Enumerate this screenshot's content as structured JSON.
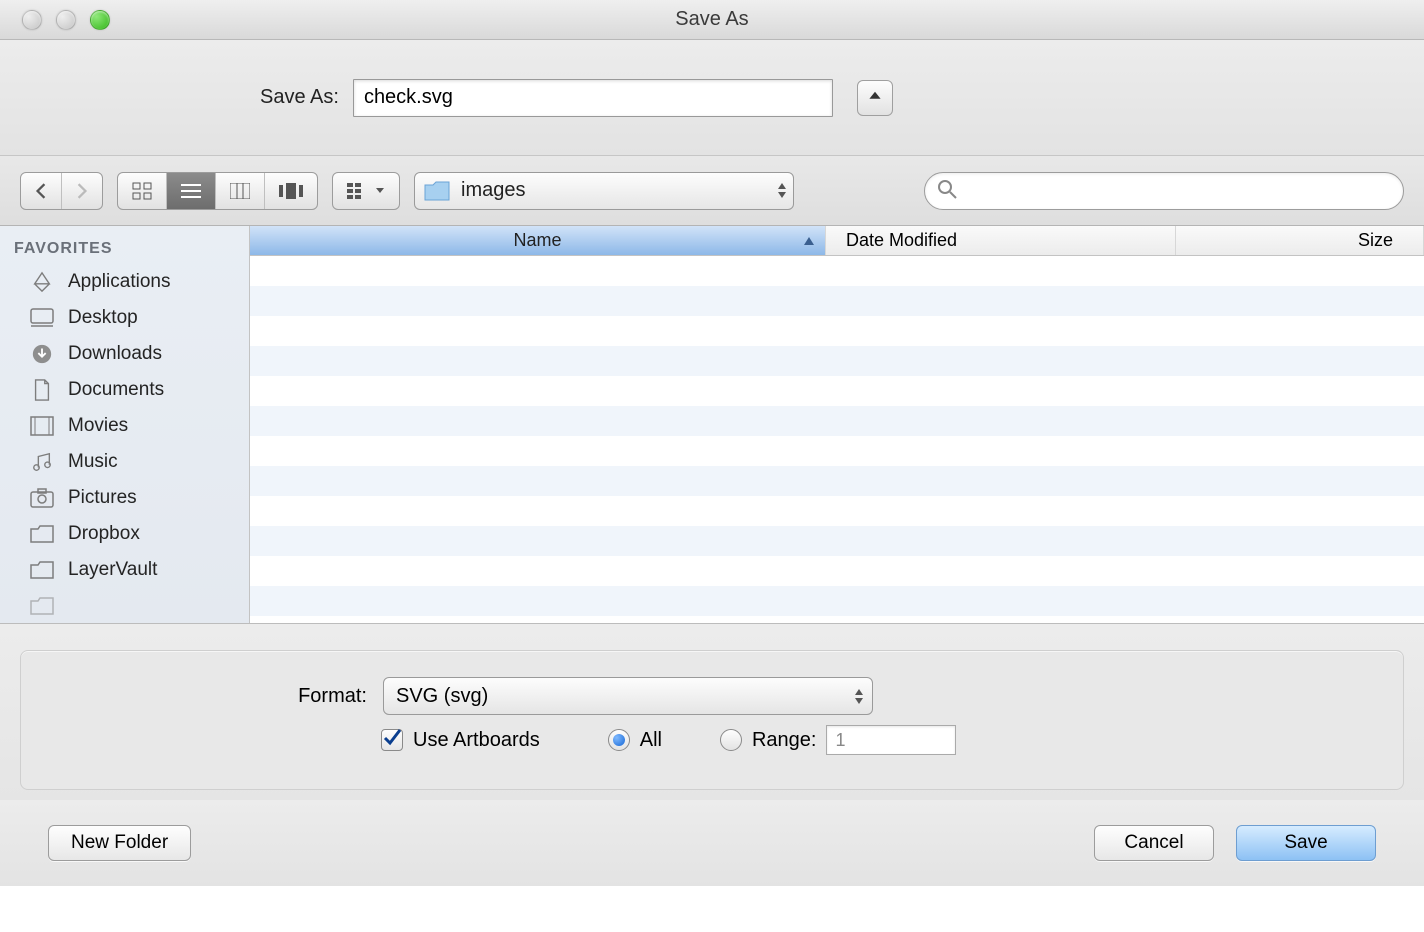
{
  "window": {
    "title": "Save As"
  },
  "saveas": {
    "label": "Save As:",
    "filename": "check.svg"
  },
  "path": {
    "folder": "images"
  },
  "search": {
    "placeholder": ""
  },
  "sidebar": {
    "header": "FAVORITES",
    "items": [
      {
        "label": "Applications",
        "icon": "applications"
      },
      {
        "label": "Desktop",
        "icon": "desktop"
      },
      {
        "label": "Downloads",
        "icon": "downloads"
      },
      {
        "label": "Documents",
        "icon": "documents"
      },
      {
        "label": "Movies",
        "icon": "movies"
      },
      {
        "label": "Music",
        "icon": "music"
      },
      {
        "label": "Pictures",
        "icon": "pictures"
      },
      {
        "label": "Dropbox",
        "icon": "folder"
      },
      {
        "label": "LayerVault",
        "icon": "folder"
      }
    ]
  },
  "columns": {
    "name": "Name",
    "date": "Date Modified",
    "size": "Size"
  },
  "format": {
    "label": "Format:",
    "value": "SVG (svg)",
    "use_artboards_label": "Use Artboards",
    "use_artboards_checked": true,
    "all_label": "All",
    "all_selected": true,
    "range_label": "Range:",
    "range_selected": false,
    "range_value": "1"
  },
  "footer": {
    "new_folder": "New Folder",
    "cancel": "Cancel",
    "save": "Save"
  }
}
